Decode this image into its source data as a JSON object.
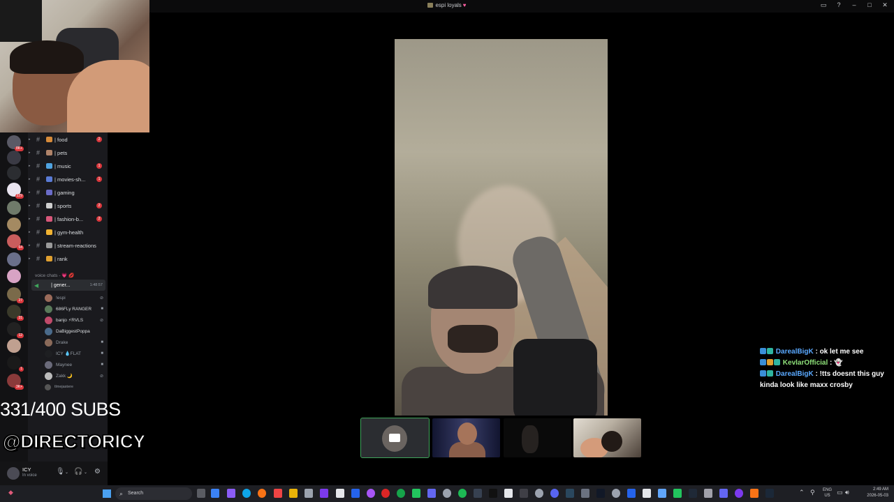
{
  "window": {
    "title": "espi loyals"
  },
  "server_badges": [
    "8K+",
    "229",
    "64",
    "27",
    "31",
    "12",
    "1",
    "3K+"
  ],
  "channels": [
    {
      "name": "| food",
      "badge": "2",
      "emoji_color": "#d78b3a"
    },
    {
      "name": "| pets",
      "badge": "",
      "emoji_color": "#b0846a"
    },
    {
      "name": "| music",
      "badge": "1",
      "emoji_color": "#4fa3e0"
    },
    {
      "name": "| movies-sh...",
      "badge": "1",
      "emoji_color": "#5a7bd6"
    },
    {
      "name": "| gaming",
      "badge": "",
      "emoji_color": "#6b6cc8"
    },
    {
      "name": "| sports",
      "badge": "2",
      "emoji_color": "#cfcfcf"
    },
    {
      "name": "| fashion-b...",
      "badge": "2",
      "emoji_color": "#d8577a"
    },
    {
      "name": "| gym-health",
      "badge": "",
      "emoji_color": "#f0b232"
    },
    {
      "name": "| stream-reactions",
      "badge": "",
      "emoji_color": "#9a9a9a"
    },
    {
      "name": "| rank",
      "badge": "",
      "emoji_color": "#e0a030"
    }
  ],
  "voice": {
    "header": "voice chats - 💗 💋",
    "channel_name": "| gener...",
    "timer": "1:48:57",
    "members": [
      {
        "name": "!espi",
        "color": "#949ba4",
        "avatar": "#9b6b5a"
      },
      {
        "name": "686FLy RANGER",
        "color": "#dbdee1",
        "avatar": "#5a7a5a"
      },
      {
        "name": "banjo ⚡RVLS",
        "color": "#dbdee1",
        "avatar": "#c04a6a"
      },
      {
        "name": "DaBiggestPoppa",
        "color": "#dbdee1",
        "avatar": "#4a6a8a"
      },
      {
        "name": "Drake",
        "color": "#949ba4",
        "avatar": "#8a6a5a"
      },
      {
        "name": "ICY 💧FLAT",
        "color": "#949ba4",
        "avatar": "#1e1f22"
      },
      {
        "name": "Maynee",
        "color": "#949ba4",
        "avatar": "#6a6a7a"
      },
      {
        "name": "Zakk 🌙",
        "color": "#949ba4",
        "avatar": "#bbbbbb"
      },
      {
        "name": "tlmejastere",
        "color": "#949ba4",
        "avatar": "#555555"
      }
    ]
  },
  "overlay": {
    "subs": "331/400 SUBS",
    "handle": "@DIRECTORICY"
  },
  "user_panel": {
    "name": "ICY",
    "status": "In voice"
  },
  "chat": [
    {
      "user": "DarealBigK",
      "sep": " : ",
      "text": "ok let me see",
      "user_color": "#5aa9ff"
    },
    {
      "user": "KevlarOfficial",
      "sep": " : ",
      "text": "👻",
      "user_color": "#8fe27a"
    },
    {
      "user": "DarealBigK",
      "sep": " : ",
      "text": "!tts doesnt this guy kinda look like maxx crosby",
      "user_color": "#5aa9ff"
    }
  ],
  "taskbar": {
    "search_placeholder": "Search",
    "lang_top": "ENG",
    "lang_bottom": "US",
    "time": "2:49 AM",
    "date": "2026-05-03"
  }
}
